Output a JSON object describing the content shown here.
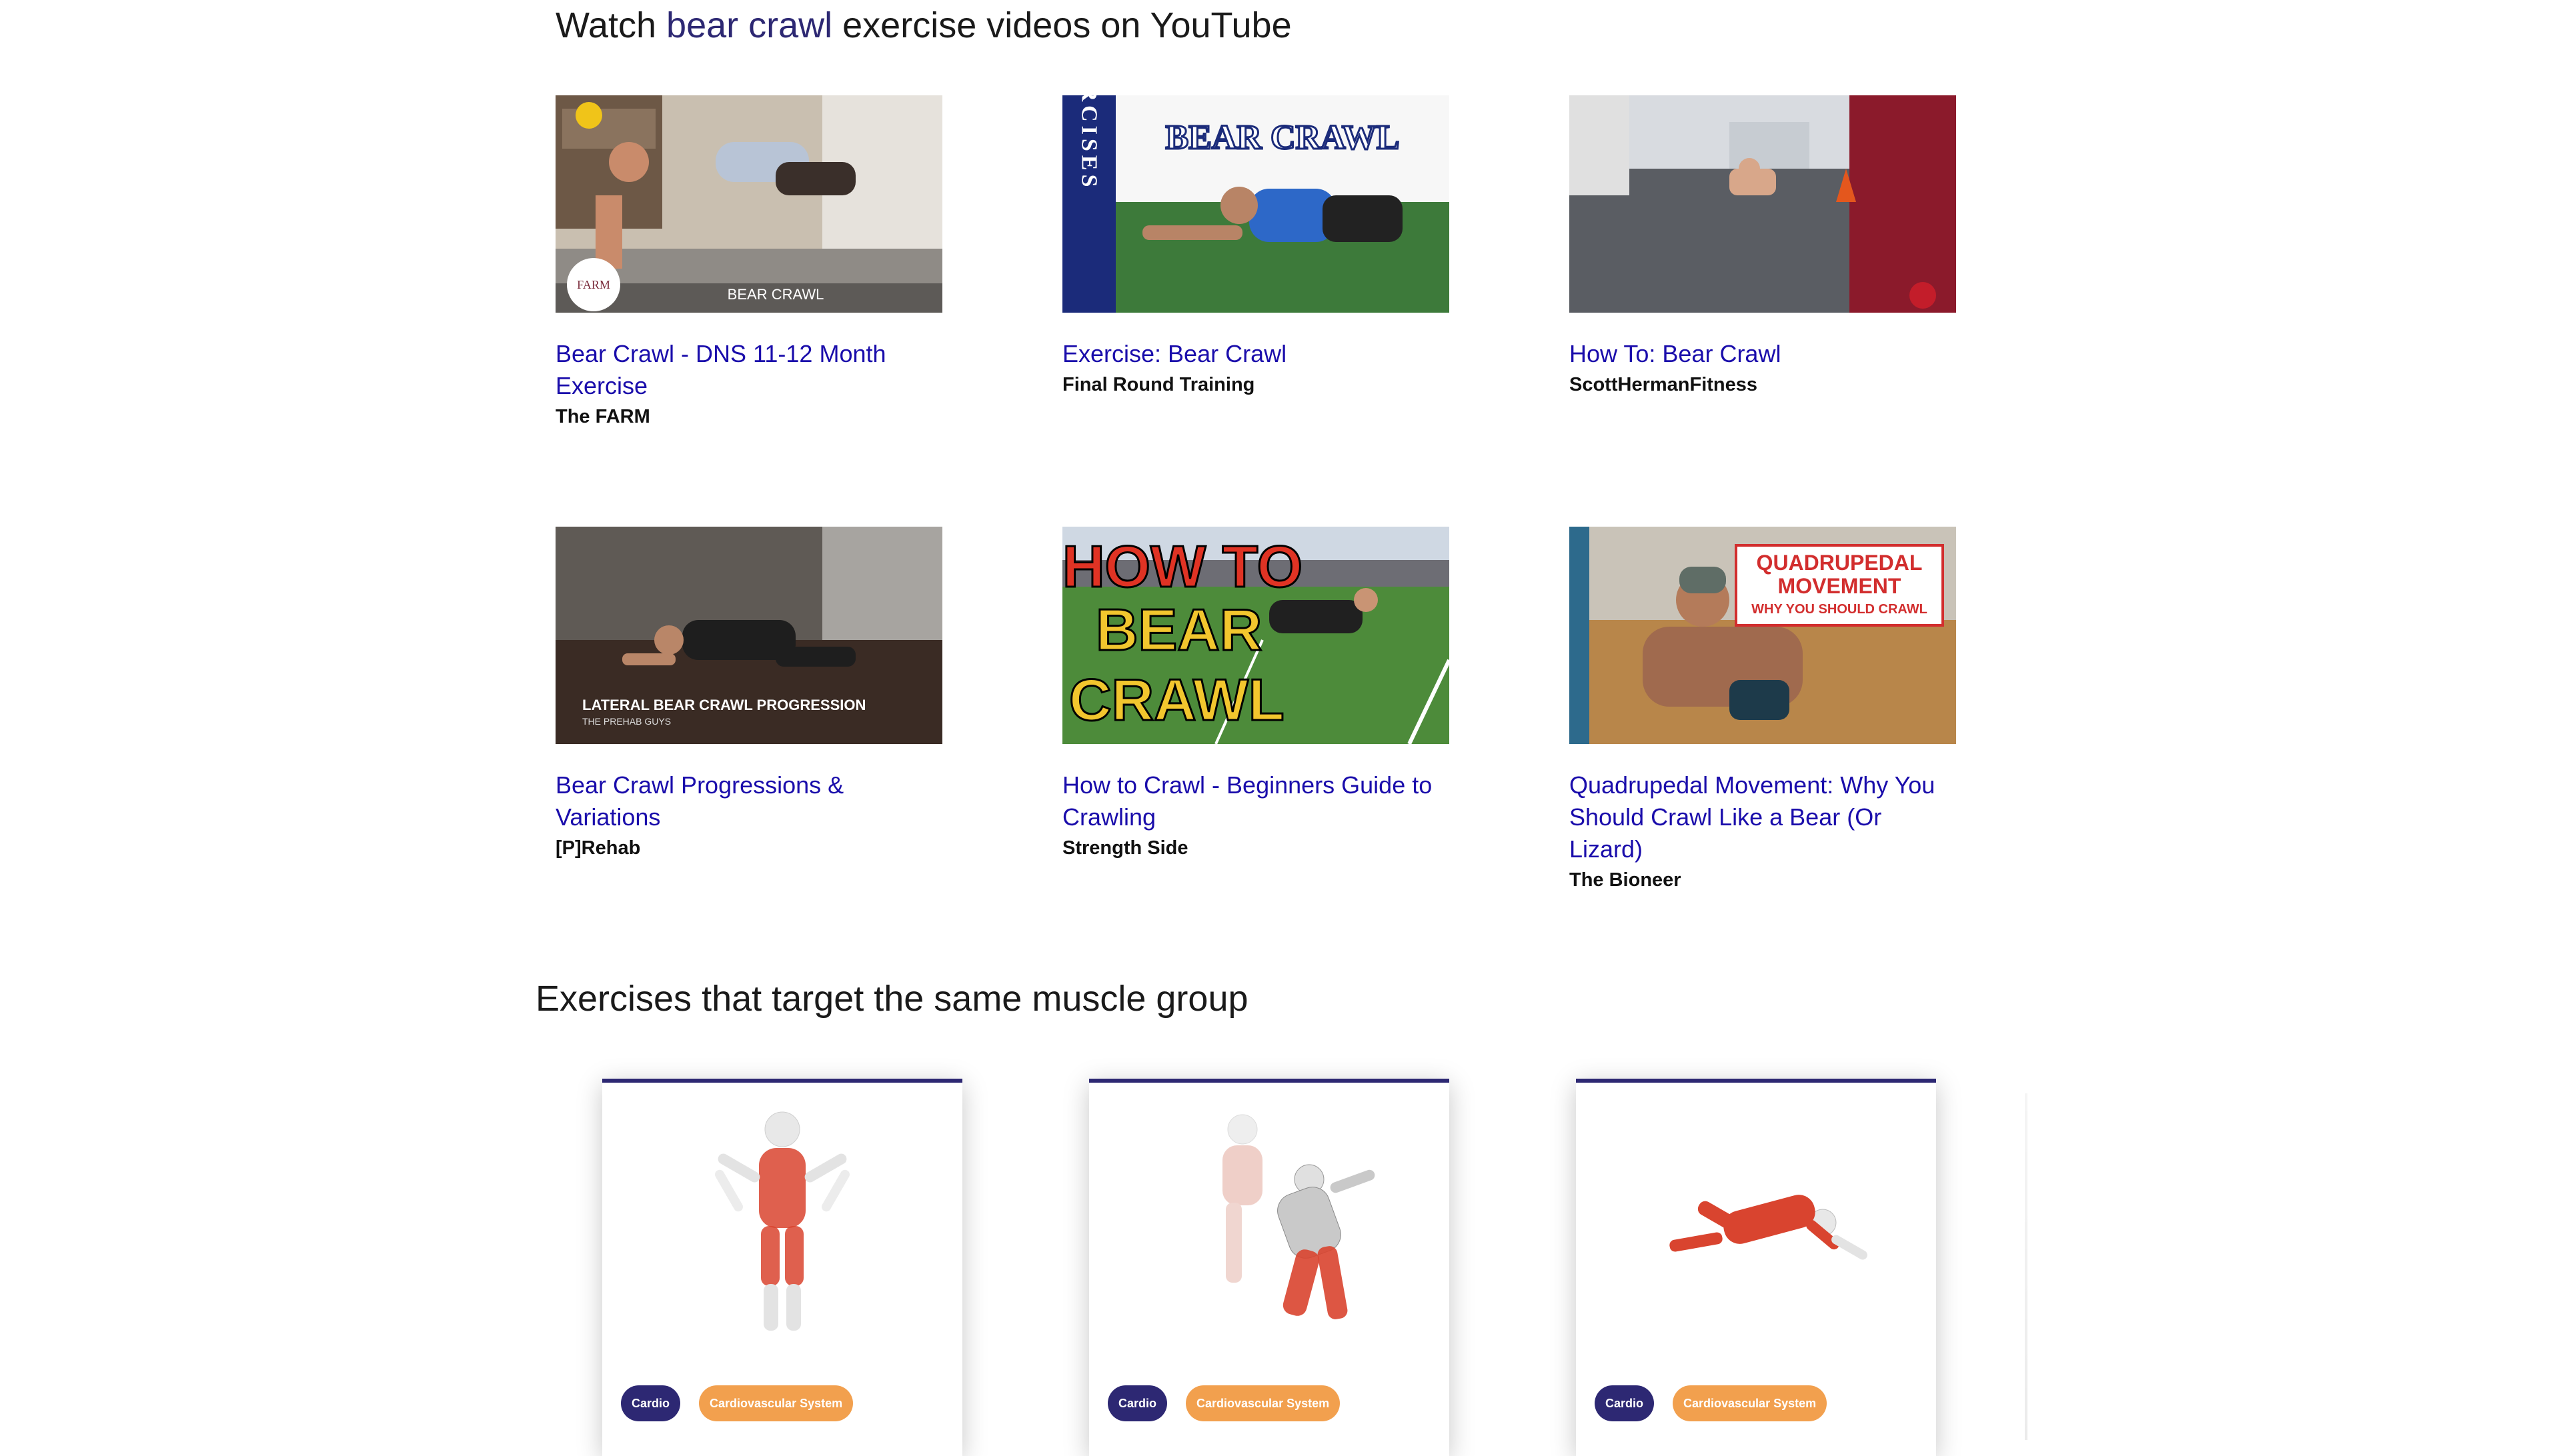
{
  "youtube_section": {
    "heading_prefix": "Watch ",
    "heading_highlight": "bear crawl",
    "heading_suffix": " exercise videos on YouTube"
  },
  "videos": [
    {
      "title": "Bear Crawl - DNS 11-12 Month Exercise",
      "channel": "The FARM",
      "thumb_logo": "FARM",
      "thumb_caption": "BEAR CRAWL"
    },
    {
      "title": "Exercise: Bear Crawl",
      "channel": "Final Round Training",
      "thumb_side_text": "EXERCISES",
      "thumb_caption": "BEAR CRAWL"
    },
    {
      "title": "How To: Bear Crawl",
      "channel": "ScottHermanFitness"
    },
    {
      "title": "Bear Crawl Progressions & Variations",
      "channel": "[P]Rehab",
      "thumb_caption": "LATERAL BEAR CRAWL PROGRESSION",
      "thumb_subcaption": "THE PREHAB GUYS"
    },
    {
      "title": "How to Crawl - Beginners Guide to Crawling",
      "channel": "Strength Side",
      "thumb_lines": [
        "HOW TO",
        "BEAR",
        "CRAWL"
      ]
    },
    {
      "title": "Quadrupedal Movement: Why You Should Crawl Like a Bear (Or Lizard)",
      "channel": "The Bioneer",
      "thumb_lines": [
        "QUADRUPEDAL",
        "MOVEMENT",
        "WHY YOU SHOULD CRAWL"
      ]
    }
  ],
  "similar_section": {
    "heading": "Exercises that target the same muscle group"
  },
  "exercise_cards": [
    {
      "tags": [
        "Cardio",
        "Cardiovascular System"
      ]
    },
    {
      "tags": [
        "Cardio",
        "Cardiovascular System"
      ]
    },
    {
      "tags": [
        "Cardio",
        "Cardiovascular System"
      ]
    }
  ],
  "colors": {
    "accent": "#2d2873",
    "link": "#1a0dab",
    "tag_orange": "#f2a04e",
    "muscle_red": "#d9442f"
  }
}
